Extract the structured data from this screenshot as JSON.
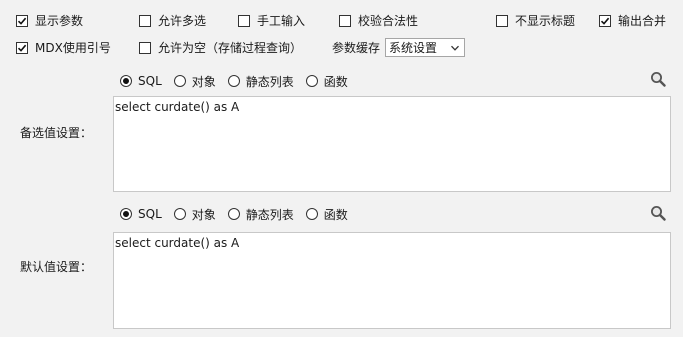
{
  "options": {
    "show_params": {
      "label": "显示参数",
      "checked": true
    },
    "allow_multi": {
      "label": "允许多选",
      "checked": false
    },
    "manual_input": {
      "label": "手工输入",
      "checked": false
    },
    "validate": {
      "label": "校验合法性",
      "checked": false
    },
    "hide_title": {
      "label": "不显示标题",
      "checked": false
    },
    "merge_output": {
      "label": "输出合并",
      "checked": true
    },
    "mdx_ref": {
      "label": "MDX使用引号",
      "checked": true
    },
    "allow_empty": {
      "label": "允许为空（存储过程查询）",
      "checked": false
    }
  },
  "param_cache": {
    "label": "参数缓存",
    "selected": "系统设置"
  },
  "candidate": {
    "label": "备选值设置：",
    "radios": [
      {
        "label": "SQL",
        "selected": true
      },
      {
        "label": "对象",
        "selected": false
      },
      {
        "label": "静态列表",
        "selected": false
      },
      {
        "label": "函数",
        "selected": false
      }
    ],
    "text": "select curdate() as A"
  },
  "default": {
    "label": "默认值设置：",
    "radios": [
      {
        "label": "SQL",
        "selected": true
      },
      {
        "label": "对象",
        "selected": false
      },
      {
        "label": "静态列表",
        "selected": false
      },
      {
        "label": "函数",
        "selected": false
      }
    ],
    "text": "select curdate() as A"
  },
  "icons": {
    "search": "search-icon",
    "check": "check-icon",
    "chevron": "chevron-down-icon"
  }
}
